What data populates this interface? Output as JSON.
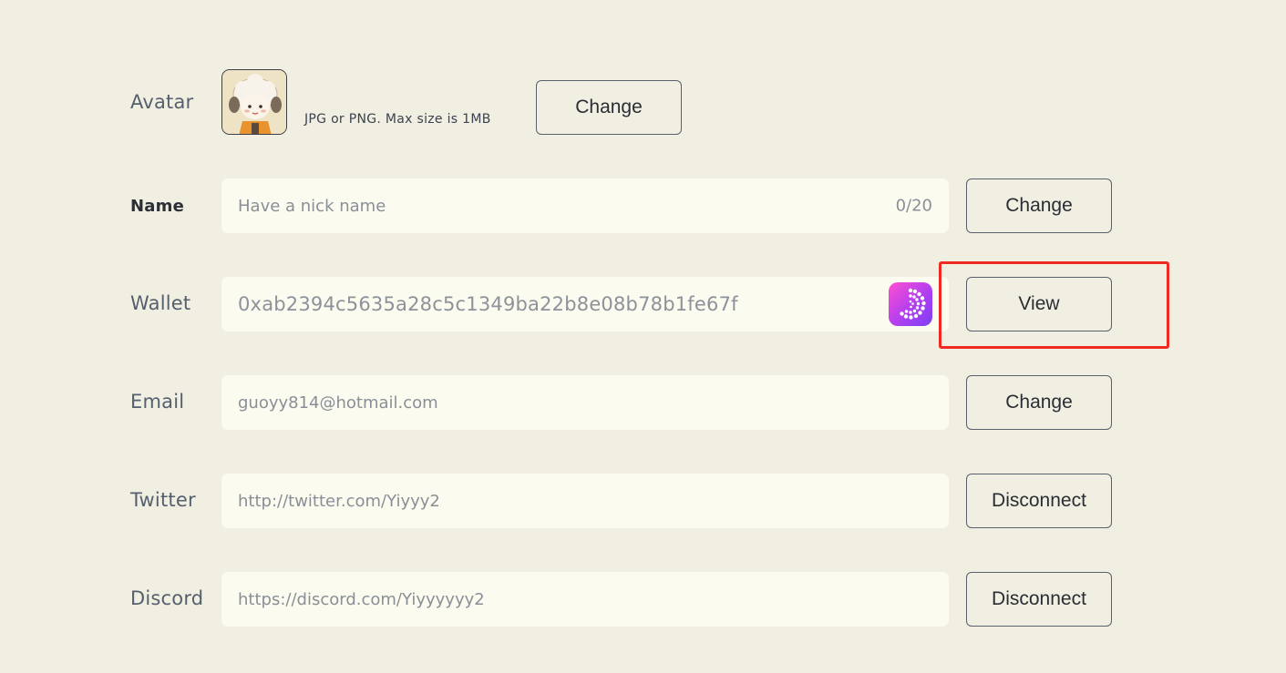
{
  "avatar": {
    "label": "Avatar",
    "hint": "JPG or PNG. Max size is  1MB",
    "change_label": "Change"
  },
  "name": {
    "label": "Name",
    "placeholder": "Have a nick name",
    "counter": "0/20",
    "change_label": "Change"
  },
  "wallet": {
    "label": "Wallet",
    "address": "0xab2394c5635a28c5c1349ba22b8e08b78b1fe67f",
    "icon": "wallet-app-icon",
    "view_label": "View"
  },
  "email": {
    "label": "Email",
    "value": "guoyy814@hotmail.com",
    "change_label": "Change"
  },
  "twitter": {
    "label": "Twitter",
    "value": "http://twitter.com/Yiyyy2",
    "disconnect_label": "Disconnect"
  },
  "discord": {
    "label": "Discord",
    "value": "https://discord.com/Yiyyyyyy2",
    "disconnect_label": "Disconnect"
  },
  "colors": {
    "background": "#f1efe2",
    "field_bg": "#fbfbef",
    "highlight": "#ee2a22"
  }
}
